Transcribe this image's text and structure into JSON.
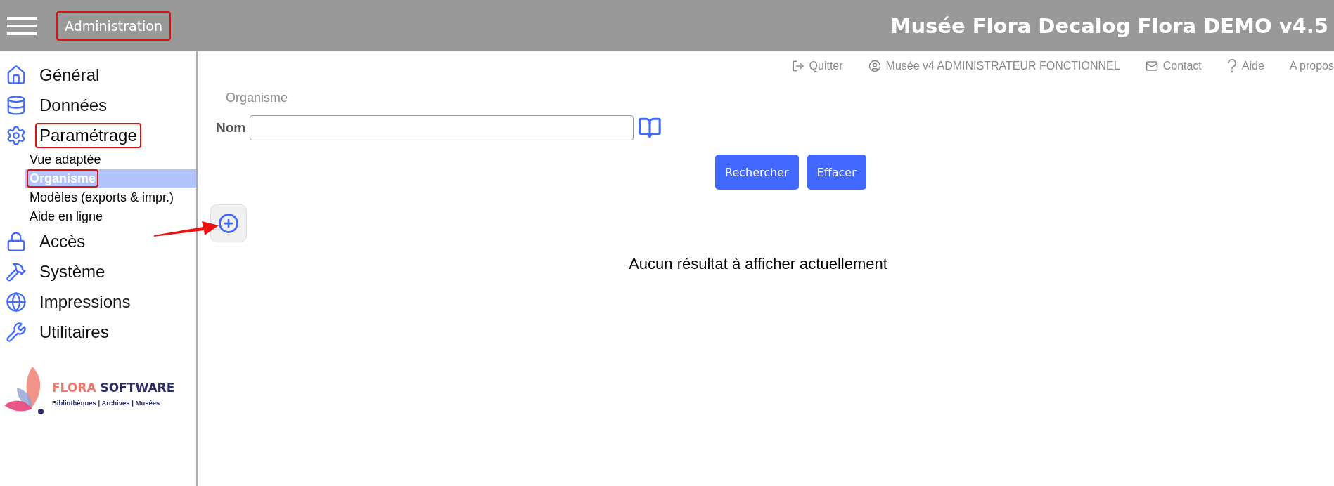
{
  "header": {
    "section": {
      "label": "Administration",
      "annotated": true
    },
    "title": "Musée Flora Decalog Flora DEMO v4.5"
  },
  "sidebar": {
    "items": [
      {
        "label": "Général",
        "expanded": false,
        "annotated": false
      },
      {
        "label": "Données",
        "expanded": false,
        "annotated": false
      },
      {
        "label": "Paramétrage",
        "expanded": true,
        "annotated": true,
        "children": [
          {
            "label": "Vue adaptée",
            "selected": false,
            "annotated": false
          },
          {
            "label": "Organisme",
            "selected": true,
            "annotated": true
          },
          {
            "label": "Modèles (exports & impr.)",
            "selected": false,
            "annotated": false
          },
          {
            "label": "Aide en ligne",
            "selected": false,
            "annotated": false
          }
        ]
      },
      {
        "label": "Accès",
        "expanded": false,
        "annotated": false
      },
      {
        "label": "Système",
        "expanded": false,
        "annotated": false
      },
      {
        "label": "Impressions",
        "expanded": false,
        "annotated": false
      },
      {
        "label": "Utilitaires",
        "expanded": false,
        "annotated": false
      }
    ],
    "logo": {
      "brand_first": "FLORA",
      "brand_second": "SOFTWARE",
      "tagline": "Bibliothèques | Archives | Musées"
    }
  },
  "top_links": [
    "Quitter",
    "Musée v4 ADMINISTRATEUR FONCTIONNEL",
    "Contact",
    "Aide",
    "A propos"
  ],
  "breadcrumb": "Organisme",
  "form": {
    "field_label": "Nom",
    "buttons": [
      "Rechercher",
      "Effacer"
    ]
  },
  "add_button": {
    "annotated": true
  },
  "empty_message": "Aucun résultat à afficher actuellement"
}
